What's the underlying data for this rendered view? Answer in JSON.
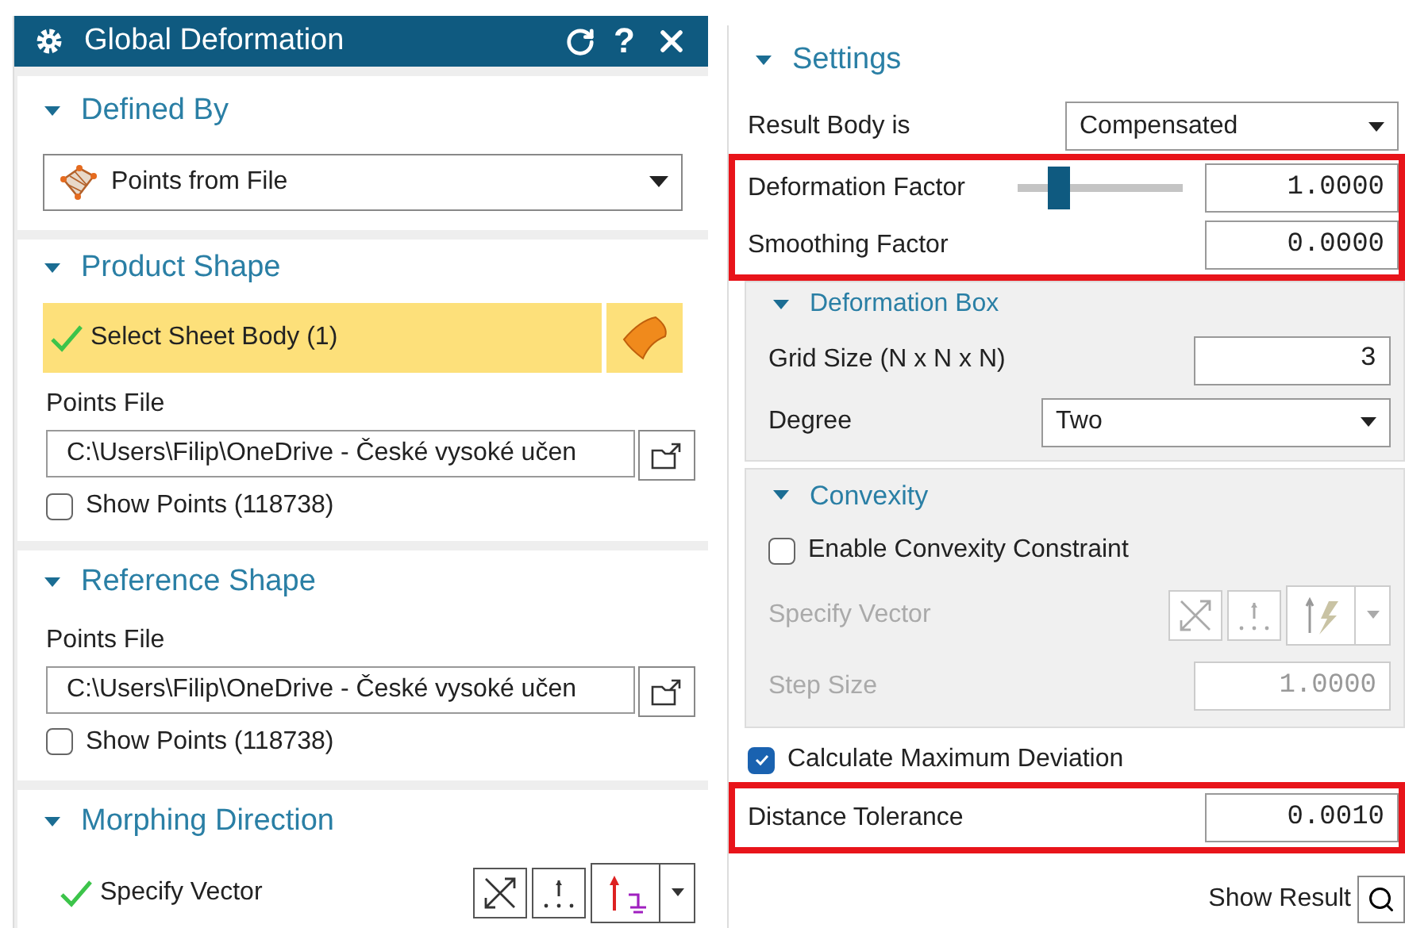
{
  "dialog": {
    "title": "Global Deformation",
    "help": "?"
  },
  "defined_by": {
    "title": "Defined By",
    "expanded": true,
    "value": "Points from File"
  },
  "product_shape": {
    "title": "Product Shape",
    "expanded": true,
    "selection": {
      "label": "Select Sheet Body (1)",
      "done": true
    },
    "points_file": {
      "label": "Points File",
      "value": "C:\\Users\\Filip\\OneDrive - České vysoké učen"
    },
    "show_points": {
      "label": "Show Points (118738)",
      "checked": false
    }
  },
  "reference_shape": {
    "title": "Reference Shape",
    "expanded": true,
    "points_file": {
      "label": "Points File",
      "value": "C:\\Users\\Filip\\OneDrive - České vysoké učen"
    },
    "show_points": {
      "label": "Show Points (118738)",
      "checked": false
    }
  },
  "morphing_direction": {
    "title": "Morphing Direction",
    "expanded": true,
    "vector": {
      "label": "Specify Vector",
      "done": true
    }
  },
  "settings": {
    "title": "Settings",
    "expanded": true,
    "result_body": {
      "label": "Result Body is",
      "value": "Compensated"
    },
    "factors": {
      "highlighted": true,
      "rows": [
        {
          "kind": "slider",
          "label": "Deformation Factor",
          "level": 0.25,
          "value": "1.0000"
        },
        {
          "kind": "field",
          "label": "Smoothing Factor",
          "value": "0.0000"
        }
      ]
    },
    "deformation_box": {
      "title": "Deformation Box",
      "expanded": true,
      "grid_size": {
        "label": "Grid Size (N x N x N)",
        "value": "3"
      },
      "degree": {
        "label": "Degree",
        "value": "Two"
      }
    },
    "convexity": {
      "title": "Convexity",
      "expanded": true,
      "enable": {
        "label": "Enable Convexity Constraint",
        "checked": false
      },
      "vector": {
        "label": "Specify Vector",
        "disabled": true
      },
      "step_size": {
        "label": "Step Size",
        "value": "1.0000",
        "disabled": true
      }
    },
    "max_deviation": {
      "label": "Calculate Maximum Deviation",
      "checked": true
    },
    "tolerance": {
      "highlighted": true,
      "label": "Distance Tolerance",
      "value": "0.0010"
    }
  },
  "show_result": {
    "label": "Show Result"
  }
}
